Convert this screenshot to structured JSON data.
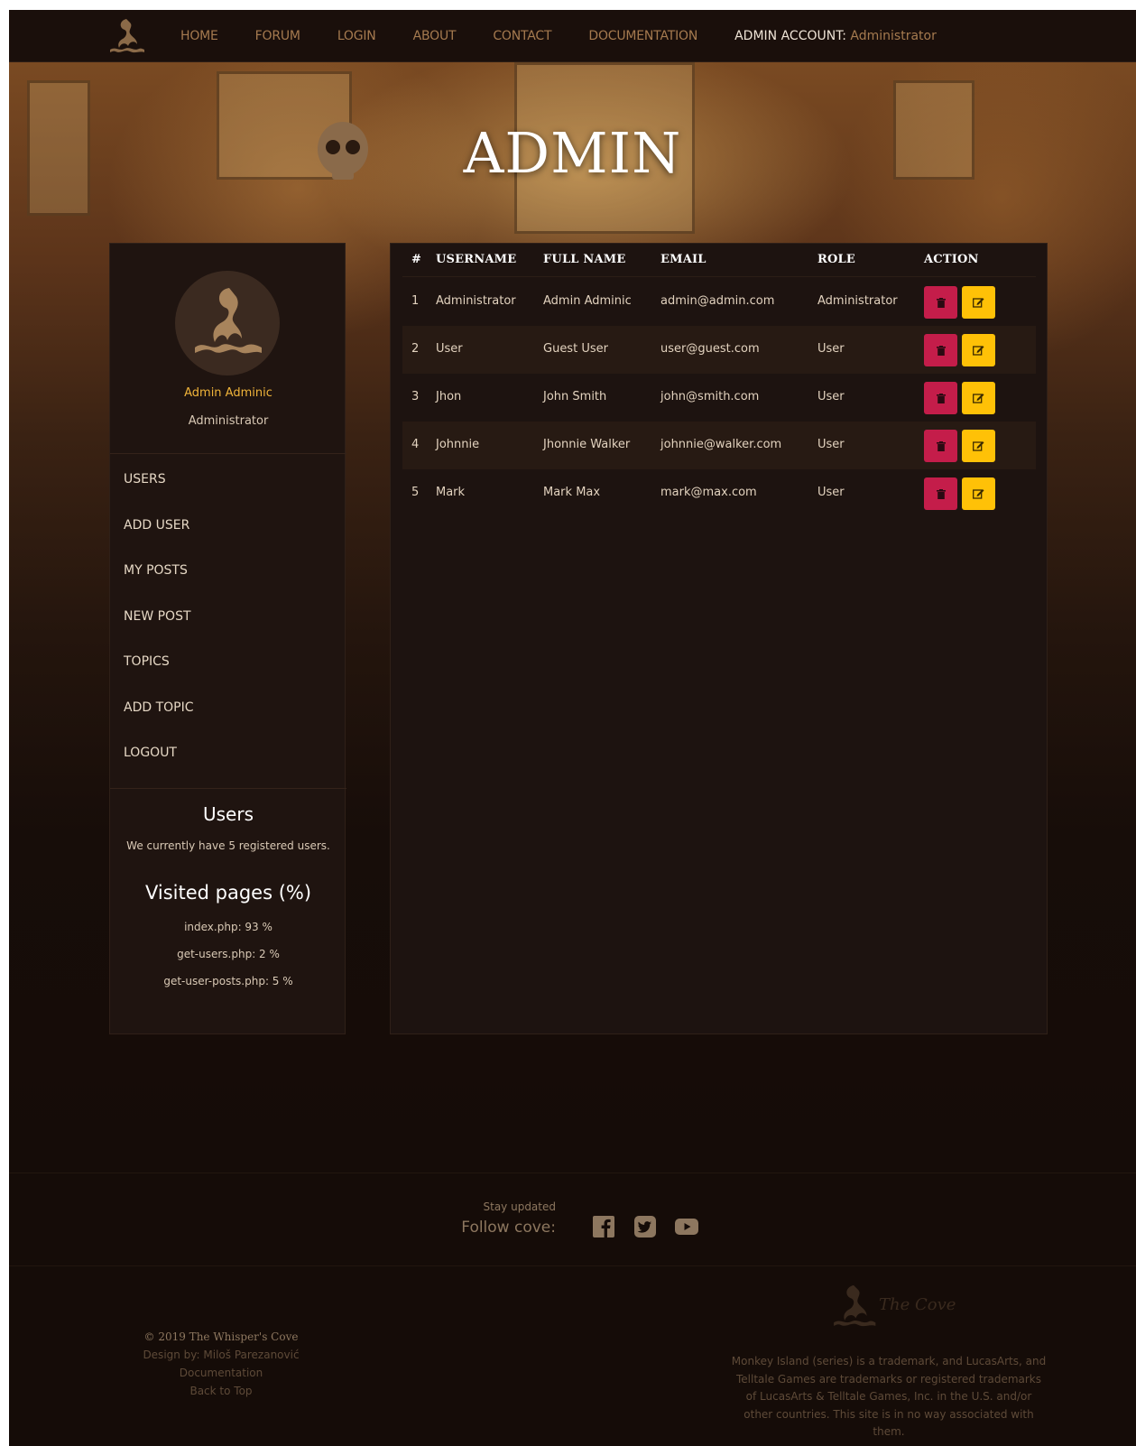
{
  "nav": {
    "items": [
      "HOME",
      "FORUM",
      "LOGIN",
      "ABOUT",
      "CONTACT",
      "DOCUMENTATION"
    ],
    "admin_label": "ADMIN ACCOUNT:",
    "admin_name": "Administrator"
  },
  "hero": {
    "title": "ADMIN"
  },
  "profile": {
    "name": "Admin Adminic",
    "role": "Administrator"
  },
  "sidebar": {
    "menu": [
      "USERS",
      "ADD USER",
      "MY POSTS",
      "NEW POST",
      "TOPICS",
      "ADD TOPIC",
      "LOGOUT"
    ],
    "users_title": "Users",
    "users_text": "We currently have 5 registered users.",
    "visited_title": "Visited pages (%)",
    "visited": [
      "index.php: 93 %",
      "get-users.php: 2 %",
      "get-user-posts.php: 5 %"
    ]
  },
  "table": {
    "headers": [
      "#",
      "USERNAME",
      "FULL NAME",
      "EMAIL",
      "ROLE",
      "ACTION"
    ],
    "rows": [
      [
        "1",
        "Administrator",
        "Admin Adminic",
        "admin@admin.com",
        "Administrator"
      ],
      [
        "2",
        "User",
        "Guest User",
        "user@guest.com",
        "User"
      ],
      [
        "3",
        "Jhon",
        "John Smith",
        "john@smith.com",
        "User"
      ],
      [
        "4",
        "Johnnie",
        "Jhonnie Walker",
        "johnnie@walker.com",
        "User"
      ],
      [
        "5",
        "Mark",
        "Mark Max",
        "mark@max.com",
        "User"
      ]
    ]
  },
  "footer": {
    "stay": "Stay updated",
    "follow": "Follow cove:",
    "social_icons": [
      "facebook-icon",
      "twitter-icon",
      "youtube-icon"
    ],
    "copyright": "© 2019 The Whisper's Cove",
    "design": "Design by: Miloš Parezanović",
    "documentation": "Documentation",
    "back_to_top": "Back to Top",
    "brand": "The Cove",
    "legal": "Monkey Island (series) is a trademark, and LucasArts, and Telltale Games are trademarks or registered trademarks of LucasArts & Telltale Games, Inc. in the U.S. and/or other countries. This site is in no way associated with them."
  },
  "colors": {
    "accent": "#f0b43a",
    "delete": "#c41d4a",
    "edit": "#ffc107",
    "nav_link": "#a57a4f"
  }
}
